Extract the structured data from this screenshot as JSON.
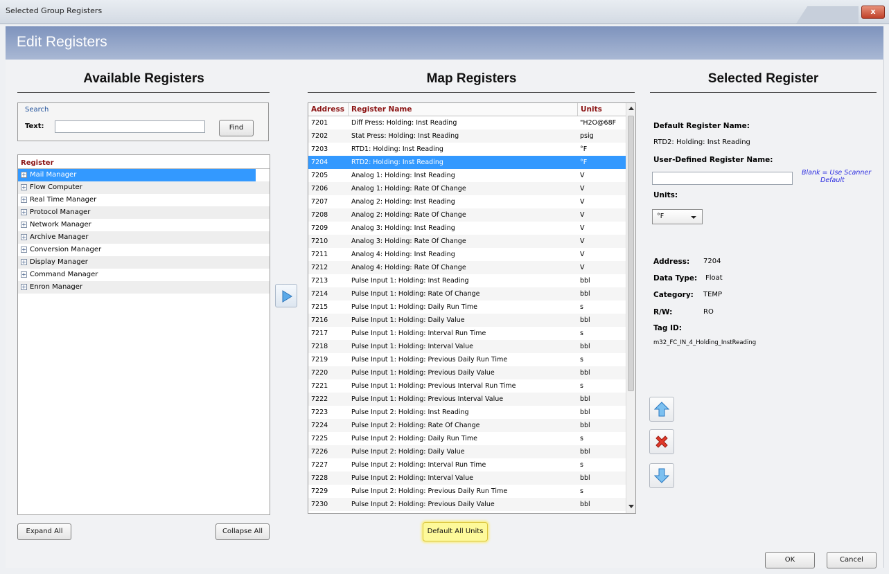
{
  "window": {
    "title": "Selected Group Registers",
    "close_label": "x"
  },
  "header": {
    "title": "Edit Registers"
  },
  "available": {
    "title": "Available Registers",
    "search_label": "Search",
    "text_label": "Text:",
    "search_value": "",
    "find_label": "Find",
    "column_header": "Register",
    "items": [
      "Mail Manager",
      "Flow Computer",
      "Real Time Manager",
      "Protocol Manager",
      "Network Manager",
      "Archive Manager",
      "Conversion Manager",
      "Display Manager",
      "Command Manager",
      "Enron Manager"
    ],
    "expand_all_label": "Expand All",
    "collapse_all_label": "Collapse All"
  },
  "map": {
    "title": "Map Registers",
    "columns": [
      "Address",
      "Register Name",
      "Units"
    ],
    "rows": [
      [
        "7201",
        "Diff Press: Holding: Inst Reading",
        "\"H2O@68F"
      ],
      [
        "7202",
        "Stat Press: Holding: Inst Reading",
        "psig"
      ],
      [
        "7203",
        "RTD1: Holding: Inst Reading",
        "°F"
      ],
      [
        "7204",
        "RTD2: Holding: Inst Reading",
        "°F"
      ],
      [
        "7205",
        "Analog 1: Holding: Inst Reading",
        "V"
      ],
      [
        "7206",
        "Analog 1: Holding: Rate Of Change",
        "V"
      ],
      [
        "7207",
        "Analog 2: Holding: Inst Reading",
        "V"
      ],
      [
        "7208",
        "Analog 2: Holding: Rate Of Change",
        "V"
      ],
      [
        "7209",
        "Analog 3: Holding: Inst Reading",
        "V"
      ],
      [
        "7210",
        "Analog 3: Holding: Rate Of Change",
        "V"
      ],
      [
        "7211",
        "Analog 4: Holding: Inst Reading",
        "V"
      ],
      [
        "7212",
        "Analog 4: Holding: Rate Of Change",
        "V"
      ],
      [
        "7213",
        "Pulse Input 1: Holding: Inst Reading",
        "bbl"
      ],
      [
        "7214",
        "Pulse Input 1: Holding: Rate Of Change",
        "bbl"
      ],
      [
        "7215",
        "Pulse Input 1: Holding: Daily Run Time",
        "s"
      ],
      [
        "7216",
        "Pulse Input 1: Holding: Daily Value",
        "bbl"
      ],
      [
        "7217",
        "Pulse Input 1: Holding: Interval Run Time",
        "s"
      ],
      [
        "7218",
        "Pulse Input 1: Holding: Interval Value",
        "bbl"
      ],
      [
        "7219",
        "Pulse Input 1: Holding: Previous Daily Run Time",
        "s"
      ],
      [
        "7220",
        "Pulse Input 1: Holding: Previous Daily Value",
        "bbl"
      ],
      [
        "7221",
        "Pulse Input 1: Holding: Previous Interval Run Time",
        "s"
      ],
      [
        "7222",
        "Pulse Input 1: Holding: Previous Interval Value",
        "bbl"
      ],
      [
        "7223",
        "Pulse Input 2: Holding: Inst Reading",
        "bbl"
      ],
      [
        "7224",
        "Pulse Input 2: Holding: Rate Of Change",
        "bbl"
      ],
      [
        "7225",
        "Pulse Input 2: Holding: Daily Run Time",
        "s"
      ],
      [
        "7226",
        "Pulse Input 2: Holding: Daily Value",
        "bbl"
      ],
      [
        "7227",
        "Pulse Input 2: Holding: Interval Run Time",
        "s"
      ],
      [
        "7228",
        "Pulse Input 2: Holding: Interval Value",
        "bbl"
      ],
      [
        "7229",
        "Pulse Input 2: Holding: Previous Daily Run Time",
        "s"
      ],
      [
        "7230",
        "Pulse Input 2: Holding: Previous Daily Value",
        "bbl"
      ]
    ],
    "default_units_label": "Default All Units"
  },
  "selected": {
    "title": "Selected Register",
    "default_name_label": "Default Register Name:",
    "default_name_value": "RTD2: Holding: Inst Reading",
    "user_name_label": "User-Defined Register Name:",
    "user_name_value": "",
    "blank_note_1": "Blank = Use Scanner",
    "blank_note_2": "Default",
    "units_label": "Units:",
    "units_value": "°F",
    "address_label": "Address:",
    "address_value": "7204",
    "datatype_label": "Data Type:",
    "datatype_value": "Float",
    "category_label": "Category:",
    "category_value": "TEMP",
    "rw_label": "R/W:",
    "rw_value": "RO",
    "tagid_label": "Tag ID:",
    "tagid_value": "m32_FC_IN_4_Holding_InstReading"
  },
  "footer": {
    "ok_label": "OK",
    "cancel_label": "Cancel"
  },
  "colors": {
    "selection": "#3399ff",
    "header_red": "#8b1313",
    "header_band": "#7e93bd",
    "highlight": "#fdf99a"
  },
  "icons": {
    "transfer": "arrow-right-icon",
    "move_up": "arrow-up-icon",
    "remove": "red-x-icon",
    "move_down": "arrow-down-icon"
  }
}
